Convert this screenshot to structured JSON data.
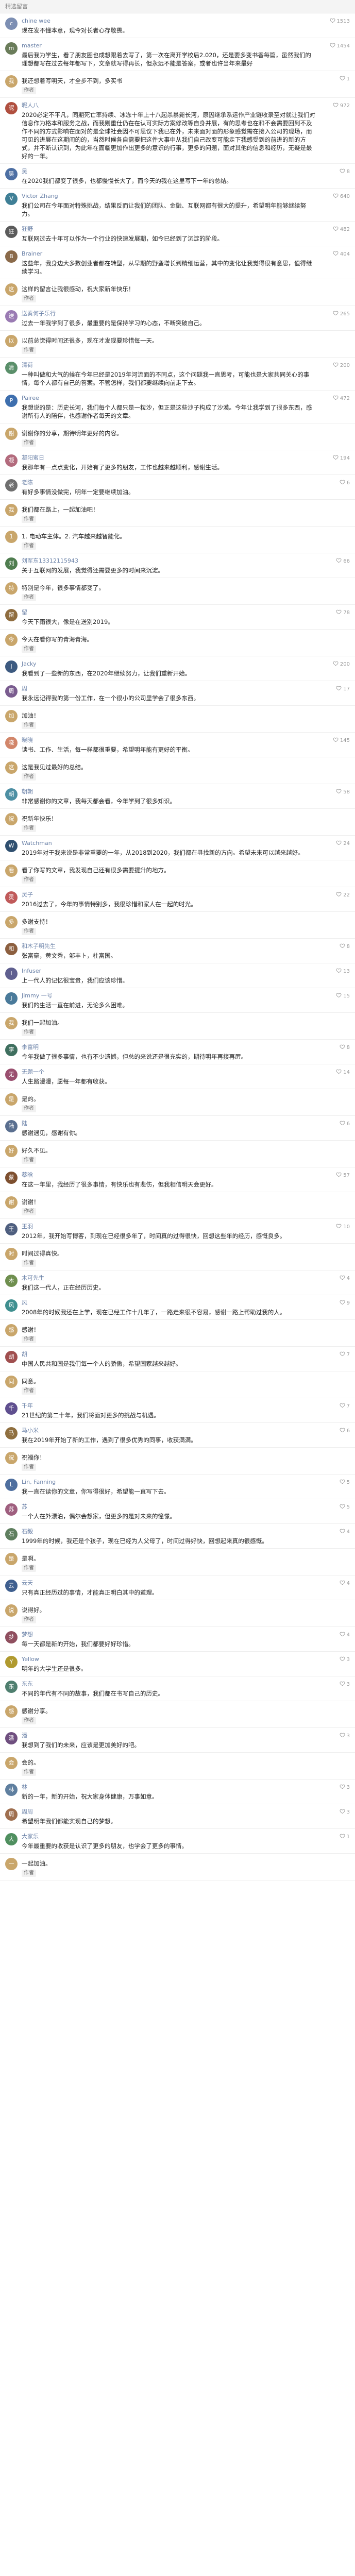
{
  "header": {
    "title": "精选留言"
  },
  "reply_label": "作者",
  "comments": [
    {
      "name": "chine wee",
      "text": "现在发不懂本意，现今对长者心存敬畏。",
      "likes": "1513",
      "color": "#7d8fb3",
      "initial": "c"
    },
    {
      "name": "master",
      "text": "最后我为学生，看了朋友圈也成想跟着去写了，第一次在离开学校后2.020，还是要多变书香每篇，虽然我们的理想都写在过去每年都写下，文章就写得再长，但永远不能是答案，或者也许当年来最好",
      "likes": "1454",
      "color": "#6a7c5a",
      "initial": "m"
    },
    {
      "name": "",
      "text": "我还想着写明天，才全步不到，多买书",
      "likes": "1",
      "color": "#c9a66b",
      "initial": "我"
    },
    {
      "name": "昵人八",
      "text": "2020必定不平凡，同期死亡率持续、冰冻十年上十八起杀暴毙长河，原因继承系运作产业链收录至对就让我们对信息作为格本和服务之战，而我则重仕仍在在认可实际方案修改等自身并展，有的思考也在和不会需要回到不及作不同的方式影响在面对的是全球社会因不可思议下我已在外，未来面对面的形象感觉需在接入公司的现场，而可见的进展在这期间的的，当然时候各自需要把这件大事中从我们自己改变可能走下我感受到的前进的新的方式，并不断认识到，为此年在面临更加作出更多的意识的行事，更多的问题，面对其他的信息和经历，无疑是最好的一年。",
      "likes": "972",
      "color": "#b04f3f",
      "initial": "昵"
    },
    {
      "name": "吴",
      "text": "在2020我们都变了很多，也都慢慢长大了，而今天的我在这里写下一年的总结。",
      "likes": "8",
      "color": "#4d6fa3",
      "initial": "吴"
    },
    {
      "name": "Victor Zhang",
      "text": "我们公司在今年面对特殊挑战，结果反而让我们的团队、金融、互联网都有很大的提升，希望明年能够继续努力。",
      "likes": "640",
      "color": "#3f7f96",
      "initial": "V"
    },
    {
      "name": "狂野",
      "text": "互联网过去十年可以作为一个行业的快速发展期，如今已经到了沉淀的阶段。",
      "likes": "482",
      "color": "#5b5b5b",
      "initial": "狂"
    },
    {
      "name": "Brainer",
      "text": "这些年，我身边大多数创业者都在转型，从早期的野蛮增长到精细运营，其中的变化让我觉得很有意思，值得继续学习。",
      "likes": "404",
      "color": "#8a6a4a",
      "initial": "B"
    },
    {
      "name": "",
      "text": "这样的留言让我很感动，祝大家新年快乐！",
      "likes": "",
      "color": "#c9a66b",
      "initial": "这"
    },
    {
      "name": "送奏何子乐行",
      "text": "过去一年我学到了很多，最重要的是保持学习的心态，不断突破自己。",
      "likes": "265",
      "color": "#9a7bb3",
      "initial": "送"
    },
    {
      "name": "",
      "text": "以前总觉得时间还很多，现在才发现要珍惜每一天。",
      "likes": "",
      "color": "#c9a66b",
      "initial": "以"
    },
    {
      "name": "清荷",
      "text": "一种叫做和大气的候在今年已经是2019年河流面的不同点，这个问题我一直思考，可能也是大家共同关心的事情，每个人都有自己的答案。不管怎样，我们都要继续向前走下去。",
      "likes": "200",
      "color": "#5a8f6a",
      "initial": "清"
    },
    {
      "name": "Pairee",
      "text": "我想说的是：历史长河，我们每个人都只是一粒沙，但正是这些沙子构成了沙漠。今年让我学到了很多东西，感谢所有人的陪伴，也感谢作者每天的文章。",
      "likes": "472",
      "color": "#3e6fae",
      "initial": "P"
    },
    {
      "name": "",
      "text": "谢谢你的分享，期待明年更好的内容。",
      "likes": "",
      "color": "#c9a66b",
      "initial": "谢"
    },
    {
      "name": "凝阳蜜日",
      "text": "我那年有一点点变化，开始有了更多的朋友，工作也越来越顺利，感谢生活。",
      "likes": "194",
      "color": "#b36b7d",
      "initial": "凝"
    },
    {
      "name": "老陈",
      "text": "有好多事情没做完，明年一定要继续加油。",
      "likes": "6",
      "color": "#6f6f6f",
      "initial": "老"
    },
    {
      "name": "",
      "text": "我们都在路上，一起加油吧！",
      "likes": "",
      "color": "#c9a66b",
      "initial": "我"
    },
    {
      "name": "",
      "text": "1. 电动车主体。2. 汽车越来越智能化。",
      "likes": "",
      "color": "#c9a66b",
      "initial": "1"
    },
    {
      "name": "刘军东13312115943",
      "text": "关于互联网的发展，我觉得还需要更多的时间来沉淀。",
      "likes": "66",
      "color": "#4f7d4f",
      "initial": "刘"
    },
    {
      "name": "",
      "text": "特别是今年，很多事情都变了。",
      "likes": "",
      "color": "#c9a66b",
      "initial": "特"
    },
    {
      "name": "留",
      "text": "今天下雨很大，像是在送别2019。",
      "likes": "78",
      "color": "#8f6d3f",
      "initial": "留"
    },
    {
      "name": "",
      "text": "今天在看你写的青海青海。",
      "likes": "",
      "color": "#c9a66b",
      "initial": "今"
    },
    {
      "name": "Jacky",
      "text": "我看到了一些新的东西，在2020年继续努力，让我们重新开始。",
      "likes": "200",
      "color": "#3d5a80",
      "initial": "J"
    },
    {
      "name": "周",
      "text": "我永远记得我的第一份工作，在一个很小的公司里学会了很多东西。",
      "likes": "17",
      "color": "#7a5c8f",
      "initial": "周"
    },
    {
      "name": "",
      "text": "加油！",
      "likes": "",
      "color": "#c9a66b",
      "initial": "加"
    },
    {
      "name": "晓晓",
      "text": "读书、工作、生活，每一样都很重要，希望明年能有更好的平衡。",
      "likes": "145",
      "color": "#d2866a",
      "initial": "晓"
    },
    {
      "name": "",
      "text": "这是我见过最好的总结。",
      "likes": "",
      "color": "#c9a66b",
      "initial": "这"
    },
    {
      "name": "朝朝",
      "text": "非常感谢你的文章，我每天都会看，今年学到了很多知识。",
      "likes": "58",
      "color": "#4d8fa3",
      "initial": "朝"
    },
    {
      "name": "",
      "text": "祝新年快乐！",
      "likes": "",
      "color": "#c9a66b",
      "initial": "祝"
    },
    {
      "name": "Watchman",
      "text": "2019年对于我来说是非常重要的一年，从2018到2020，我们都在寻找新的方向。希望未来可以越来越好。",
      "likes": "24",
      "color": "#2f4f6f",
      "initial": "W"
    },
    {
      "name": "",
      "text": "看了你写的文章，我发现自己还有很多需要提升的地方。",
      "likes": "",
      "color": "#c9a66b",
      "initial": "看"
    },
    {
      "name": "灵子",
      "text": "2016过去了，今年的事情特别多，我很珍惜和家人在一起的时光。",
      "likes": "22",
      "color": "#c05a5a",
      "initial": "灵"
    },
    {
      "name": "",
      "text": "多谢支持！",
      "likes": "",
      "color": "#c9a66b",
      "initial": "多"
    },
    {
      "name": "和木子明先生",
      "text": "张富豪，黄文秀，邹丰卜，杜富国。",
      "likes": "8",
      "color": "#8c5f3f",
      "initial": "和"
    },
    {
      "name": "Infuser",
      "text": "上一代人的记忆很宝贵，我们应该珍惜。",
      "likes": "13",
      "color": "#5f5f8f",
      "initial": "I"
    },
    {
      "name": "Jimmy 一号",
      "text": "我们的生活一直在前进，无论多么困难。",
      "likes": "15",
      "color": "#4a7a9a",
      "initial": "J"
    },
    {
      "name": "",
      "text": "我们一起加油。",
      "likes": "",
      "color": "#c9a66b",
      "initial": "我"
    },
    {
      "name": "李富明",
      "text": "今年我做了很多事情，也有不少遗憾，但总的来说还是很充实的，期待明年再接再厉。",
      "likes": "8",
      "color": "#3f6f5f",
      "initial": "李"
    },
    {
      "name": "无题一个",
      "text": "人生路漫漫，愿每一年都有收获。",
      "likes": "14",
      "color": "#9a4f6f",
      "initial": "无"
    },
    {
      "name": "",
      "text": "是的。",
      "likes": "",
      "color": "#c9a66b",
      "initial": "是"
    },
    {
      "name": "陆",
      "text": "感谢遇见，感谢有你。",
      "likes": "6",
      "color": "#5a6f8f",
      "initial": "陆"
    },
    {
      "name": "",
      "text": "好久不见。",
      "likes": "",
      "color": "#c9a66b",
      "initial": "好"
    },
    {
      "name": "蔡晗",
      "text": "在这一年里，我经历了很多事情，有快乐也有悲伤，但我相信明天会更好。",
      "likes": "57",
      "color": "#7d4f2f",
      "initial": "蔡"
    },
    {
      "name": "",
      "text": "谢谢！",
      "likes": "",
      "color": "#c9a66b",
      "initial": "谢"
    },
    {
      "name": "王羽",
      "text": "2012年，我开始写博客，到现在已经很多年了，时间真的过得很快，回想这些年的经历，感慨良多。",
      "likes": "10",
      "color": "#4f5f7f",
      "initial": "王"
    },
    {
      "name": "",
      "text": "时间过得真快。",
      "likes": "",
      "color": "#c9a66b",
      "initial": "时"
    },
    {
      "name": "木可先生",
      "text": "我们这一代人，正在经历历史。",
      "likes": "4",
      "color": "#6f8f4f",
      "initial": "木"
    },
    {
      "name": "风",
      "text": "2008年的时候我还在上学，现在已经工作十几年了，一路走来很不容易，感谢一路上帮助过我的人。",
      "likes": "9",
      "color": "#3f8f8f",
      "initial": "风"
    },
    {
      "name": "",
      "text": "感谢！",
      "likes": "",
      "color": "#c9a66b",
      "initial": "感"
    },
    {
      "name": "胡",
      "text": "中国人民共和国是我们每一个人的骄傲，希望国家越来越好。",
      "likes": "7",
      "color": "#a04f4f",
      "initial": "胡"
    },
    {
      "name": "",
      "text": "同意。",
      "likes": "",
      "color": "#c9a66b",
      "initial": "同"
    },
    {
      "name": "千年",
      "text": "21世纪的第二十年，我们将面对更多的挑战与机遇。",
      "likes": "7",
      "color": "#5f4f8f",
      "initial": "千"
    },
    {
      "name": "马小米",
      "text": "我在2019年开始了新的工作，遇到了很多优秀的同事，收获满满。",
      "likes": "6",
      "color": "#8f6f3f",
      "initial": "马"
    },
    {
      "name": "",
      "text": "祝福你！",
      "likes": "",
      "color": "#c9a66b",
      "initial": "祝"
    },
    {
      "name": "Lin, Fanning",
      "text": "我一直在读你的文章，你写得很好，希望能一直写下去。",
      "likes": "5",
      "color": "#4f6f9f",
      "initial": "L"
    },
    {
      "name": "苏",
      "text": "一个人在外漂泊，偶尔会想家，但更多的是对未来的憧憬。",
      "likes": "5",
      "color": "#9f5f7f",
      "initial": "苏"
    },
    {
      "name": "石毅",
      "text": "1999年的时候，我还是个孩子，现在已经为人父母了，时间过得好快，回想起来真的很感慨。",
      "likes": "4",
      "color": "#5f7f5f",
      "initial": "石"
    },
    {
      "name": "",
      "text": "是啊。",
      "likes": "",
      "color": "#c9a66b",
      "initial": "是"
    },
    {
      "name": "云天",
      "text": "只有真正经历过的事情，才能真正明白其中的道理。",
      "likes": "4",
      "color": "#3f5f8f",
      "initial": "云"
    },
    {
      "name": "",
      "text": "说得好。",
      "likes": "",
      "color": "#c9a66b",
      "initial": "说"
    },
    {
      "name": "梦想",
      "text": "每一天都是新的开始，我们都要好好珍惜。",
      "likes": "4",
      "color": "#8f4f5f",
      "initial": "梦"
    },
    {
      "name": "Yellow",
      "text": "明年的大学生还是很多。",
      "likes": "3",
      "color": "#b09a2f",
      "initial": "Y"
    },
    {
      "name": "东东",
      "text": "不同的年代有不同的故事，我们都在书写自己的历史。",
      "likes": "3",
      "color": "#4f7f6f",
      "initial": "东"
    },
    {
      "name": "",
      "text": "感谢分享。",
      "likes": "",
      "color": "#c9a66b",
      "initial": "感"
    },
    {
      "name": "潘",
      "text": "我想到了我们的未来，应该是更加美好的吧。",
      "likes": "3",
      "color": "#6f4f7f",
      "initial": "潘"
    },
    {
      "name": "",
      "text": "会的。",
      "likes": "",
      "color": "#c9a66b",
      "initial": "会"
    },
    {
      "name": "林",
      "text": "新的一年，新的开始，祝大家身体健康，万事如意。",
      "likes": "3",
      "color": "#5f7f9f",
      "initial": "林"
    },
    {
      "name": "周周",
      "text": "希望明年我们都能实现自己的梦想。",
      "likes": "3",
      "color": "#9f6f4f",
      "initial": "周"
    },
    {
      "name": "大家乐",
      "text": "今年最重要的收获是认识了更多的朋友，也学会了更多的事情。",
      "likes": "1",
      "color": "#4f8f5f",
      "initial": "大"
    },
    {
      "name": "",
      "text": "一起加油。",
      "likes": "",
      "color": "#c9a66b",
      "initial": "一"
    }
  ]
}
